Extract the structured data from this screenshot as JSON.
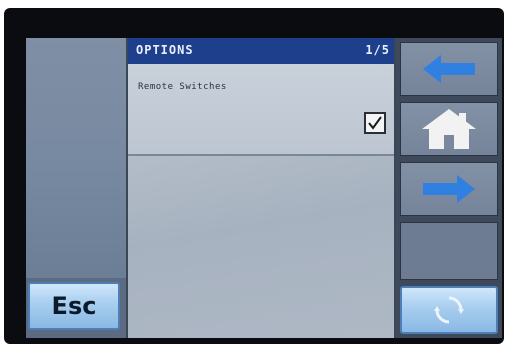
{
  "header": {
    "title": "OPTIONS",
    "page_indicator": "1/5"
  },
  "options": [
    {
      "label": "Remote Switches",
      "checked": true
    }
  ],
  "left": {
    "esc_label": "Esc"
  },
  "nav": {
    "icons": [
      "arrow-left-icon",
      "home-icon",
      "arrow-right-icon",
      "refresh-icon"
    ]
  },
  "colors": {
    "title_bar": "#1d3f8c",
    "accent_blue": "#2f80e0",
    "button_light": "#a7cdee"
  }
}
